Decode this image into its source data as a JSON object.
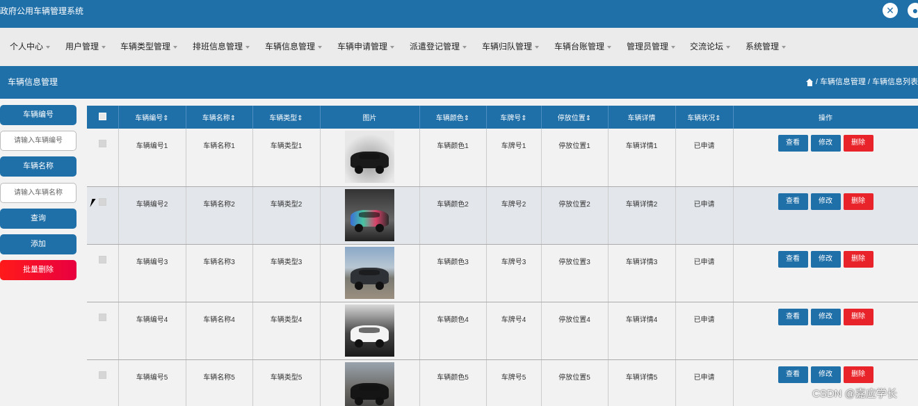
{
  "app": {
    "title": "政府公用车辆管理系统"
  },
  "nav": {
    "items": [
      {
        "label": "个人中心"
      },
      {
        "label": "用户管理"
      },
      {
        "label": "车辆类型管理"
      },
      {
        "label": "排班信息管理"
      },
      {
        "label": "车辆信息管理"
      },
      {
        "label": "车辆申请管理"
      },
      {
        "label": "派遣登记管理"
      },
      {
        "label": "车辆归队管理"
      },
      {
        "label": "车辆台账管理"
      },
      {
        "label": "管理员管理"
      },
      {
        "label": "交流论坛"
      },
      {
        "label": "系统管理"
      }
    ]
  },
  "page": {
    "title": "车辆信息管理",
    "breadcrumb": [
      "车辆信息管理",
      "车辆信息列表"
    ]
  },
  "search": {
    "code_label": "车辆编号",
    "code_placeholder": "请输入车辆编号",
    "name_label": "车辆名称",
    "name_placeholder": "请输入车辆名称",
    "query_label": "查询",
    "add_label": "添加",
    "batch_delete_label": "批量删除"
  },
  "table": {
    "headers": {
      "code": "车辆编号",
      "name": "车辆名称",
      "type": "车辆类型",
      "picture": "图片",
      "color": "车辆颜色",
      "plate": "车牌号",
      "location": "停放位置",
      "detail": "车辆详情",
      "status": "车辆状况",
      "ops": "操作"
    },
    "sort_glyph": "⇕",
    "actions": {
      "view": "查看",
      "edit": "修改",
      "delete": "删除"
    },
    "rows": [
      {
        "code": "车辆编号1",
        "name": "车辆名称1",
        "type": "车辆类型1",
        "color": "车辆颜色1",
        "plate": "车牌号1",
        "location": "停放位置1",
        "detail": "车辆详情1",
        "status": "已申请"
      },
      {
        "code": "车辆编号2",
        "name": "车辆名称2",
        "type": "车辆类型2",
        "color": "车辆颜色2",
        "plate": "车牌号2",
        "location": "停放位置2",
        "detail": "车辆详情2",
        "status": "已申请"
      },
      {
        "code": "车辆编号3",
        "name": "车辆名称3",
        "type": "车辆类型3",
        "color": "车辆颜色3",
        "plate": "车牌号3",
        "location": "停放位置3",
        "detail": "车辆详情3",
        "status": "已申请"
      },
      {
        "code": "车辆编号4",
        "name": "车辆名称4",
        "type": "车辆类型4",
        "color": "车辆颜色4",
        "plate": "车牌号4",
        "location": "停放位置4",
        "detail": "车辆详情4",
        "status": "已申请"
      },
      {
        "code": "车辆编号5",
        "name": "车辆名称5",
        "type": "车辆类型5",
        "color": "车辆颜色5",
        "plate": "车牌号5",
        "location": "停放位置5",
        "detail": "车辆详情5",
        "status": "已申请"
      }
    ]
  },
  "icons": {
    "close": "close-icon",
    "user": "user-icon",
    "home": "home-icon"
  },
  "colors": {
    "primary": "#1f6fa8",
    "danger": "#e8242a"
  },
  "watermark": "CSDN @嘉应学长"
}
